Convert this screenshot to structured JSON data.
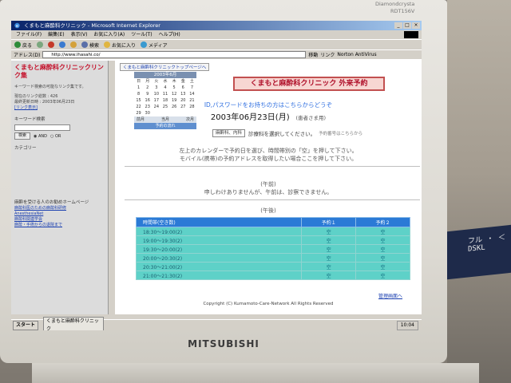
{
  "monitor": {
    "brand": "MITSUBISHI",
    "model_line1": "Diamondcrysta",
    "model_line2": "RDT156V"
  },
  "book_spine": "フル ・ ＜\nDSKL",
  "browser": {
    "window_title": "くまもと麻酔科クリニック - Microsoft Internet Explorer",
    "menu": [
      "ファイル(F)",
      "編集(E)",
      "表示(V)",
      "お気に入り(A)",
      "ツール(T)",
      "ヘルプ(H)"
    ],
    "toolbar": {
      "back": "戻る",
      "search": "検索",
      "favorites": "お気に入り",
      "media": "メディア"
    },
    "address_label": "アドレス(D)",
    "address_value": "http://www.ihasahi.co/",
    "go_label": "移動",
    "links_label": "リンク",
    "antivirus_label": "Norton AntiVirus"
  },
  "sidebar": {
    "title": "くまもと麻酔科クリニックリンク集",
    "lines": [
      "キーワード検索の可能なリンク集です。",
      "現在のリンク総数 : 426",
      "最終更新日時 : 2003年06月23日"
    ],
    "link_browse": "[リンク表示]",
    "search_head": "キーワード検索",
    "search_button": "検索",
    "and_label": "AND",
    "or_label": "OR",
    "category_head": "カテゴリー",
    "sites_head": "麻酔を受ける人のお勧めホームページ",
    "site_links": [
      "麻酔科医のための麻酔科研修",
      "AnesthesiaNet",
      "麻酔科関連学会",
      "麻酔・手術からの退院まで"
    ]
  },
  "page": {
    "top_link": "くまもと麻酔科クリニックトップページへ",
    "calendar": {
      "header": "2003年6月",
      "weekdays": [
        "日",
        "月",
        "火",
        "水",
        "木",
        "金",
        "土"
      ],
      "days": [
        "1",
        "2",
        "3",
        "4",
        "5",
        "6",
        "7",
        "8",
        "9",
        "10",
        "11",
        "12",
        "13",
        "14",
        "15",
        "16",
        "17",
        "18",
        "19",
        "20",
        "21",
        "22",
        "23",
        "24",
        "25",
        "26",
        "27",
        "28",
        "29",
        "30"
      ],
      "prev": "前月",
      "today": "当月",
      "next": "次月",
      "footer": "予約の流れ"
    },
    "banner": "くまもと麻酔科クリニック 外来予約",
    "id_notice": "ID,パスワードをお持ちの方はこちらからどうぞ",
    "date": "2003年06月23日(月)",
    "patient_type": "(患者さま用)",
    "dept_select": "麻酔科、内科",
    "dept_text": "診療科を選択してください。",
    "dept_note": "予約番号はこちらから",
    "instruction_1": "左上のカレンダーで予約日を選び、時間帯別の「空」を押して下さい。",
    "instruction_2": "モバイル(携帯)の予約アドレスを取得したい場合ここを押して下さい。",
    "morning_label": "(午前)",
    "morning_notice": "申しわけありませんが、午前は、診察できません。",
    "afternoon_label": "(午後)",
    "table": {
      "headers": [
        "時間帯(空き数)",
        "予約１",
        "予約２"
      ],
      "rows": [
        {
          "time": "18:30～19:00(2)",
          "slot1": "空",
          "slot2": "空"
        },
        {
          "time": "19:00～19:30(2)",
          "slot1": "空",
          "slot2": "空"
        },
        {
          "time": "19:30～20:00(2)",
          "slot1": "空",
          "slot2": "空"
        },
        {
          "time": "20:00～20:30(2)",
          "slot1": "空",
          "slot2": "空"
        },
        {
          "time": "20:30～21:00(2)",
          "slot1": "空",
          "slot2": "空"
        },
        {
          "time": "21:00～21:30(2)",
          "slot1": "空",
          "slot2": "空"
        }
      ]
    },
    "admin_link": "管理画面へ",
    "copyright": "Copyright (C) Kumamoto-Care-Network All Rights Reserved"
  },
  "taskbar": {
    "start": "スタート",
    "task": "くまもと麻酔科クリニック",
    "clock": "10:04"
  }
}
